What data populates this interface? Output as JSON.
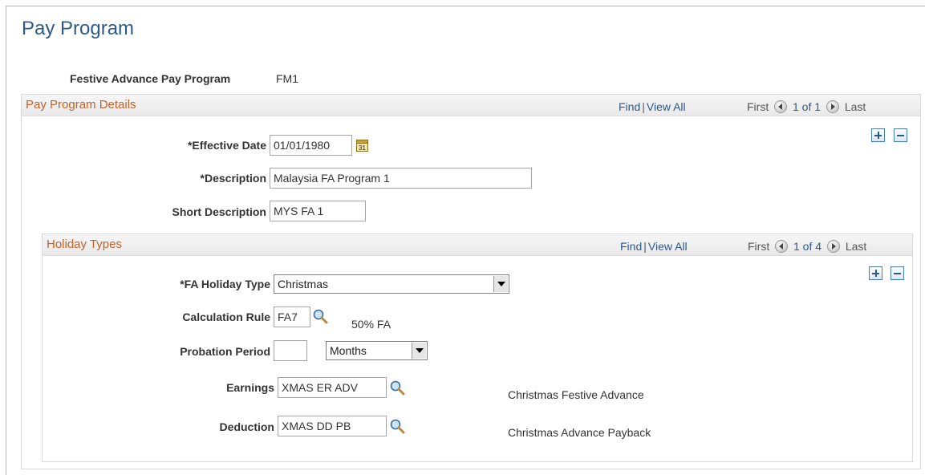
{
  "page": {
    "title": "Pay Program"
  },
  "program": {
    "label": "Festive Advance Pay Program",
    "value": "FM1"
  },
  "details": {
    "title": "Pay Program Details",
    "find": "Find",
    "sep": "|",
    "view_all": "View All",
    "first": "First",
    "count": "1 of 1",
    "last": "Last",
    "effective_date_label": "*Effective Date",
    "effective_date": "01/01/1980",
    "description_label": "*Description",
    "description": "Malaysia FA Program 1",
    "short_description_label": "Short Description",
    "short_description": "MYS FA 1"
  },
  "holiday": {
    "title": "Holiday Types",
    "find": "Find",
    "sep": "|",
    "view_all": "View All",
    "first": "First",
    "count": "1 of 4",
    "last": "Last",
    "type_label": "*FA Holiday Type",
    "type_value": "Christmas",
    "calc_rule_label": "Calculation Rule",
    "calc_rule": "FA7",
    "calc_rule_desc": "50% FA",
    "probation_label": "Probation Period",
    "probation_value": "",
    "probation_unit": "Months",
    "earnings_label": "Earnings",
    "earnings": "XMAS ER ADV",
    "earnings_desc": "Christmas Festive Advance",
    "deduction_label": "Deduction",
    "deduction": "XMAS DD PB",
    "deduction_desc": "Christmas Advance Payback"
  },
  "icons": {
    "calendar": "calendar-icon",
    "lookup": "magnifier-icon",
    "add": "plus-icon",
    "delete": "minus-icon",
    "prev": "arrow-left-icon",
    "next": "arrow-right-icon"
  }
}
